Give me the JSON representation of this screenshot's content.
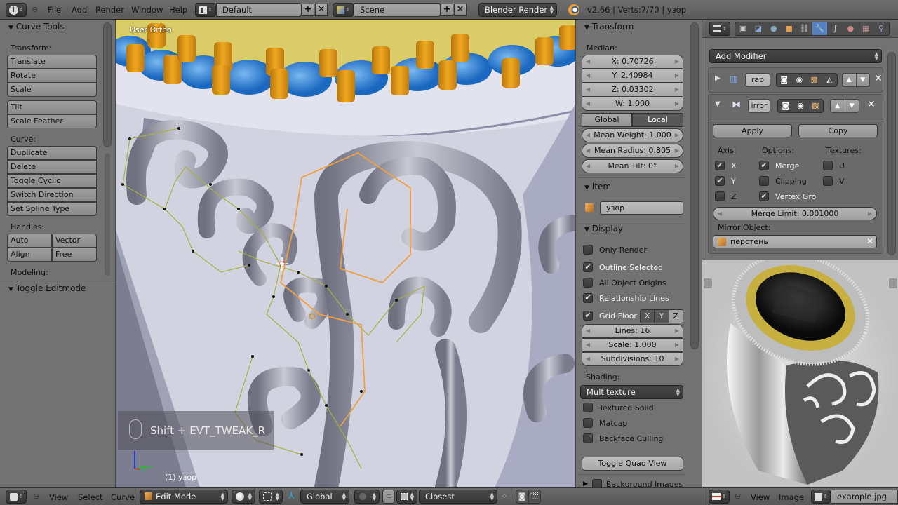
{
  "topbar": {
    "menus": [
      "File",
      "Add",
      "Render",
      "Window",
      "Help"
    ],
    "screen_layout": "Default",
    "scene": "Scene",
    "render_engine": "Blender Render",
    "stats": "v2.66 | Verts:7/70 | узор"
  },
  "tool_panel": {
    "title": "Curve Tools",
    "transform_label": "Transform:",
    "transform_buttons": [
      "Translate",
      "Rotate",
      "Scale"
    ],
    "extra_buttons": [
      "Tilt",
      "Scale Feather"
    ],
    "curve_label": "Curve:",
    "curve_buttons": [
      "Duplicate",
      "Delete",
      "Toggle Cyclic",
      "Switch Direction",
      "Set Spline Type"
    ],
    "handles_label": "Handles:",
    "handles": [
      "Auto",
      "Vector",
      "Align",
      "Free"
    ],
    "modeling_label": "Modeling:",
    "toggle_editmode": "Toggle Editmode"
  },
  "viewport": {
    "view_name": "User Ortho",
    "operator_hint": "Shift + EVT_TWEAK_R",
    "object_info": "(1) узор"
  },
  "n_panel": {
    "transform_title": "Transform",
    "median_label": "Median:",
    "x": "X: 0.70726",
    "y": "Y: 2.40984",
    "z": "Z: 0.03302",
    "w": "W: 1.000",
    "space_options": [
      "Global",
      "Local"
    ],
    "space_selected": "Local",
    "mean_weight": "Mean Weight: 1.000",
    "mean_radius": "Mean Radius: 0.805",
    "mean_tilt": "Mean Tilt: 0°",
    "item_title": "Item",
    "item_name": "узор",
    "display_title": "Display",
    "only_render": {
      "label": "Only Render",
      "checked": false
    },
    "outline_selected": {
      "label": "Outline Selected",
      "checked": true
    },
    "all_object_origins": {
      "label": "All Object Origins",
      "checked": false
    },
    "relationship_lines": {
      "label": "Relationship Lines",
      "checked": true
    },
    "grid_floor": {
      "label": "Grid Floor",
      "checked": true
    },
    "grid_axes": [
      "X",
      "Y",
      "Z"
    ],
    "lines": "Lines: 16",
    "scale": "Scale: 1.000",
    "subdivisions": "Subdivisions: 10",
    "shading_label": "Shading:",
    "shading_value": "Multitexture",
    "textured_solid": {
      "label": "Textured Solid",
      "checked": false
    },
    "matcap": {
      "label": "Matcap",
      "checked": false
    },
    "backface_culling": {
      "label": "Backface Culling",
      "checked": false
    },
    "toggle_quad_view": "Toggle Quad View",
    "background_images": "Background Images"
  },
  "properties": {
    "add_modifier": "Add Modifier",
    "modifier1_name": "rap",
    "modifier2_name": "irror",
    "apply": "Apply",
    "copy": "Copy",
    "axis_label": "Axis:",
    "options_label": "Options:",
    "textures_label": "Textures:",
    "axis": [
      {
        "label": "X",
        "checked": true
      },
      {
        "label": "Y",
        "checked": true
      },
      {
        "label": "Z",
        "checked": false
      }
    ],
    "options": [
      {
        "label": "Merge",
        "checked": true
      },
      {
        "label": "Clipping",
        "checked": false
      },
      {
        "label": "Vertex Gro",
        "checked": true
      }
    ],
    "textures": [
      {
        "label": "U",
        "checked": false
      },
      {
        "label": "V",
        "checked": false
      }
    ],
    "merge_limit": "Merge Limit: 0.001000",
    "mirror_object_label": "Mirror Object:",
    "mirror_object": "перстень"
  },
  "bottombar_3d": {
    "menus": [
      "View",
      "Select",
      "Curve"
    ],
    "mode": "Edit Mode",
    "orientation": "Global",
    "snap_target": "Closest"
  },
  "bottombar_image": {
    "menus": [
      "View",
      "Image"
    ],
    "image_name": "example.jpg"
  },
  "colors": {
    "accent_blue": "#5680c2",
    "selected_curve": "#f0a040",
    "curve_wire": "#a8b040",
    "prongs": "#e09a18",
    "gems": "#3a8ad8"
  }
}
